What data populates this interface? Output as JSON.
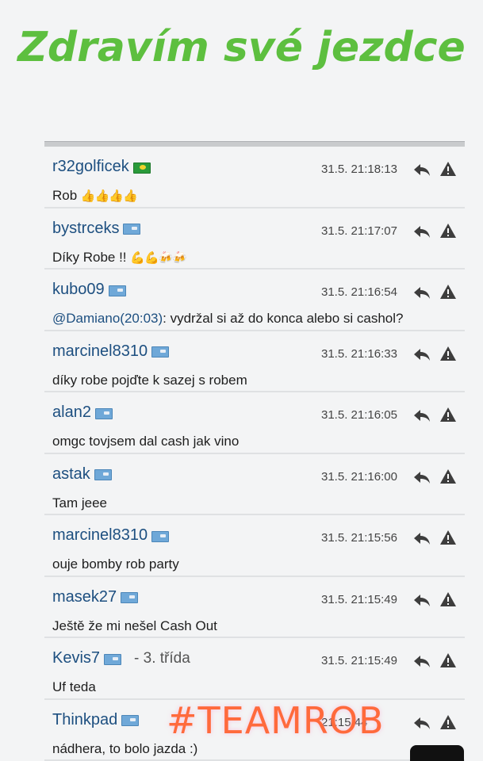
{
  "headline": "Zdravím své jezdce",
  "overlay_tag": "#TEAMROB",
  "comments": [
    {
      "user": "r32golficek",
      "flag": "br",
      "badge": "",
      "time": "31.5. 21:18:13",
      "mention": "",
      "text": "Rob",
      "emoji": "👍👍👍👍"
    },
    {
      "user": "bystrceks",
      "flag": "cz",
      "badge": "",
      "time": "31.5. 21:17:07",
      "mention": "",
      "text": "Díky Robe !!",
      "emoji": "💪💪🍻🍻"
    },
    {
      "user": "kubo09",
      "flag": "sk",
      "badge": "",
      "time": "31.5. 21:16:54",
      "mention": "@Damiano(20:03)",
      "text": ": vydržal si až do konca alebo si cashol?",
      "emoji": ""
    },
    {
      "user": "marcinel8310",
      "flag": "cz",
      "badge": "",
      "time": "31.5. 21:16:33",
      "mention": "",
      "text": "díky robe pojďte k sazej s robem",
      "emoji": ""
    },
    {
      "user": "alan2",
      "flag": "cz",
      "badge": "",
      "time": "31.5. 21:16:05",
      "mention": "",
      "text": "omgc tovjsem dal cash jak vino",
      "emoji": ""
    },
    {
      "user": "astak",
      "flag": "sk",
      "badge": "",
      "time": "31.5. 21:16:00",
      "mention": "",
      "text": "Tam jeee",
      "emoji": ""
    },
    {
      "user": "marcinel8310",
      "flag": "cz",
      "badge": "",
      "time": "31.5. 21:15:56",
      "mention": "",
      "text": "ouje bomby rob party",
      "emoji": ""
    },
    {
      "user": "masek27",
      "flag": "cz",
      "badge": "",
      "time": "31.5. 21:15:49",
      "mention": "",
      "text": "Ještě že mi nešel Cash Out",
      "emoji": ""
    },
    {
      "user": "Kevis7",
      "flag": "cz",
      "badge": "- 3. třída",
      "time": "31.5. 21:15:49",
      "mention": "",
      "text": "Uf teda",
      "emoji": ""
    },
    {
      "user": "Thinkpad",
      "flag": "sk",
      "badge": "",
      "time": "21:15:44",
      "mention": "",
      "text": "nádhera, to bolo jazda :)",
      "emoji": ""
    }
  ]
}
